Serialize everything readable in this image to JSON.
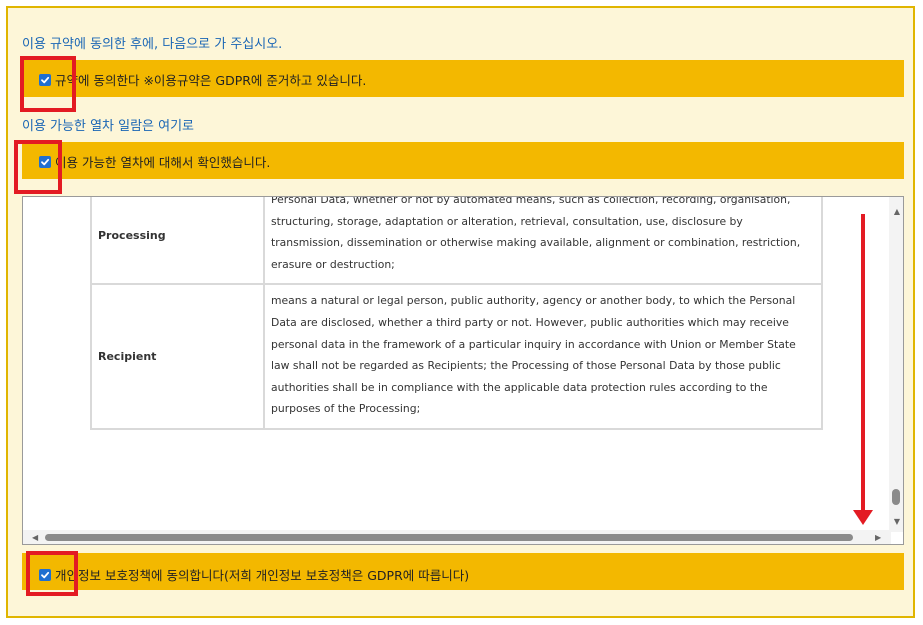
{
  "intro_agree": "이용 규약에 동의한 후에, 다음으로 가 주십시오.",
  "intro_trains": "이용 가능한 열차 일람은 여기로",
  "checkbox_terms": {
    "label": "규약에 동의한다 ※이용규약은 GDPR에 준거하고 있습니다.",
    "checked": true
  },
  "checkbox_trains": {
    "label": "이용 가능한 열차에 대해서 확인했습니다.",
    "checked": true
  },
  "checkbox_privacy": {
    "label": "개인정보 보호정책에 동의합니다(저희 개인정보 보호정책은 GDPR에 따릅니다)",
    "checked": true
  },
  "terms_table": [
    {
      "term": "Processing",
      "definition": "Personal Data, whether or not by automated means, such as collection, recording, organisation, structuring, storage, adaptation or alteration, retrieval, consultation, use, disclosure by transmission, dissemination or otherwise making available, alignment or combination, restriction, erasure or destruction;"
    },
    {
      "term": "Recipient",
      "definition": "means a natural or legal person, public authority, agency or another body, to which the Personal Data are disclosed, whether a third party or not. However, public authorities which may receive personal data in the framework of a particular inquiry in accordance with Union or Member State law shall not be regarded as Recipients; the Processing of those Personal Data by those public authorities shall be in compliance with the applicable data protection rules according to the purposes of the Processing;"
    }
  ],
  "colors": {
    "band": "#f3b800",
    "frame_border": "#e0b500",
    "frame_background": "#fdf6d8",
    "link_text": "#1a66b5",
    "highlight": "#e31b23",
    "checkbox": "#1f6fd0"
  },
  "icons": {
    "checkbox_mark": "check-icon",
    "scroll_hint": "arrow-down-icon"
  }
}
